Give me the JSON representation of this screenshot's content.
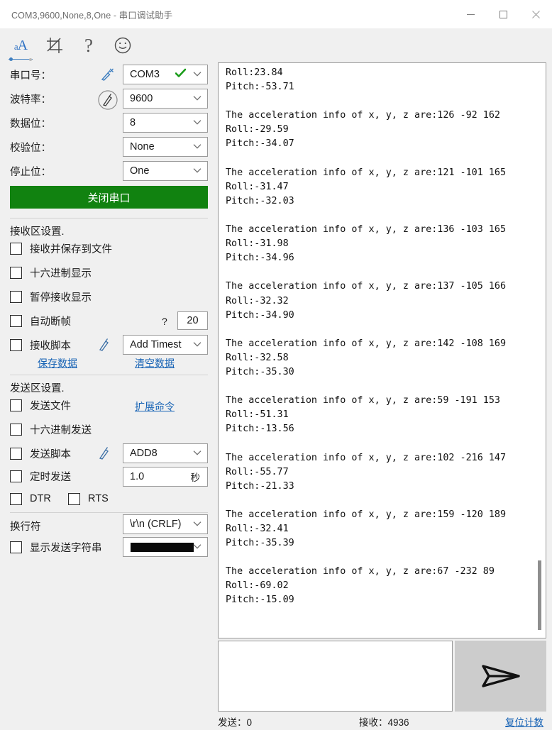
{
  "window": {
    "title": "COM3,9600,None,8,One - 串口调试助手",
    "minimize_label": "minimize",
    "maximize_label": "maximize",
    "close_label": "close"
  },
  "toolbar": {
    "font_size_glyph": "aA",
    "crop_label": "crop",
    "help_label": "?",
    "smiley_label": "smiley",
    "settings_label": "settings"
  },
  "serial_settings": {
    "port_label": "串口号：",
    "port_value": "COM3",
    "baud_label": "波特率：",
    "baud_value": "9600",
    "databits_label": "数据位：",
    "databits_value": "8",
    "parity_label": "校验位：",
    "parity_value": "None",
    "stopbits_label": "停止位：",
    "stopbits_value": "One",
    "toggle_button": "关闭串口"
  },
  "receive_settings": {
    "title": "接收区设置.",
    "items": [
      {
        "label": "接收并保存到文件",
        "checked": false
      },
      {
        "label": "十六进制显示",
        "checked": false
      },
      {
        "label": "暂停接收显示",
        "checked": false
      },
      {
        "label": "自动断帧",
        "checked": false
      },
      {
        "label": "接收脚本",
        "checked": false
      }
    ],
    "frame_hint": "?",
    "frame_value": "20",
    "script_value": "Add Timest",
    "save_link": "保存数据",
    "clear_link": "清空数据"
  },
  "send_settings": {
    "title": "发送区设置.",
    "items": [
      {
        "label": "发送文件",
        "checked": false
      },
      {
        "label": "十六进制发送",
        "checked": false
      },
      {
        "label": "发送脚本",
        "checked": false
      },
      {
        "label": "定时发送",
        "checked": false
      }
    ],
    "extend_link": "扩展命令",
    "script_value": "ADD8",
    "interval_value": "1.0",
    "interval_unit": "秒",
    "dtr_label": "DTR",
    "rts_label": "RTS",
    "dtr_checked": false,
    "rts_checked": false
  },
  "newline_settings": {
    "label": "换行符",
    "value": "\\r\\n (CRLF)",
    "show_string_label": "显示发送字符串",
    "show_string_checked": false,
    "color_value": "#0a0a0a"
  },
  "terminal": {
    "content": "Roll:23.84\nPitch:-53.71\n\nThe acceleration info of x, y, z are:126 -92 162\nRoll:-29.59\nPitch:-34.07\n\nThe acceleration info of x, y, z are:121 -101 165\nRoll:-31.47\nPitch:-32.03\n\nThe acceleration info of x, y, z are:136 -103 165\nRoll:-31.98\nPitch:-34.96\n\nThe acceleration info of x, y, z are:137 -105 166\nRoll:-32.32\nPitch:-34.90\n\nThe acceleration info of x, y, z are:142 -108 169\nRoll:-32.58\nPitch:-35.30\n\nThe acceleration info of x, y, z are:59 -191 153\nRoll:-51.31\nPitch:-13.56\n\nThe acceleration info of x, y, z are:102 -216 147\nRoll:-55.77\nPitch:-21.33\n\nThe acceleration info of x, y, z are:159 -120 189\nRoll:-32.41\nPitch:-35.39\n\nThe acceleration info of x, y, z are:67 -232 89\nRoll:-69.02\nPitch:-15.09"
  },
  "send_input": {
    "value": "",
    "placeholder": ""
  },
  "send_button": {
    "label": "send"
  },
  "statusbar": {
    "sent": "发送：0",
    "received": "接收：4936",
    "reset_link": "复位计数"
  },
  "colors": {
    "accent_green": "#118210",
    "link_blue": "#1763b5",
    "toolbar_blue": "#2f72c4"
  }
}
